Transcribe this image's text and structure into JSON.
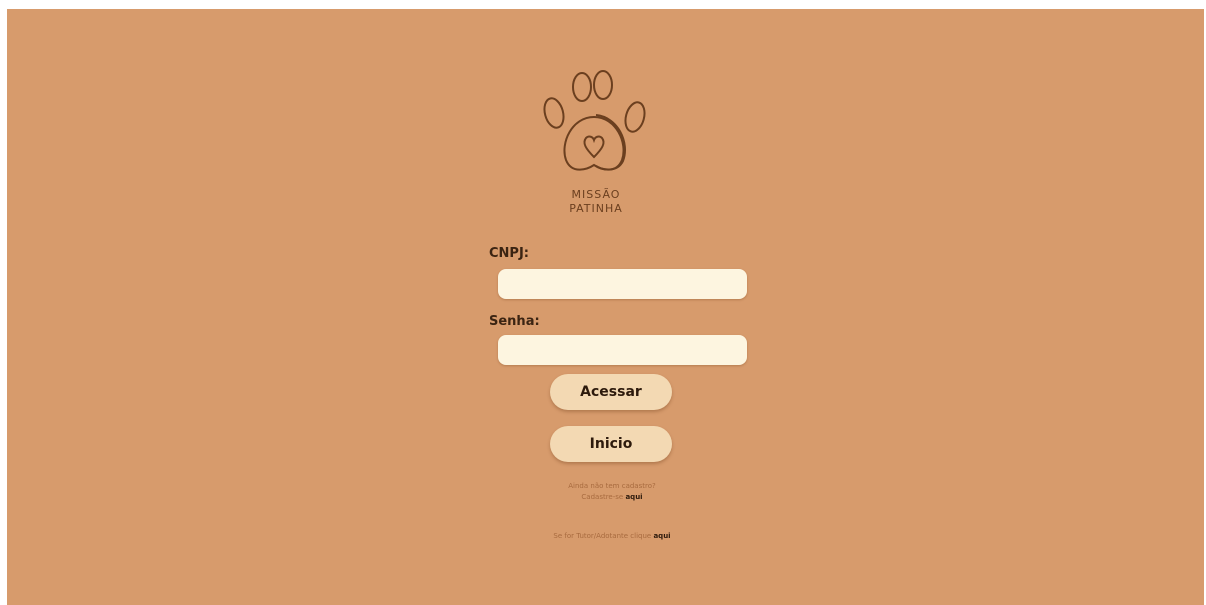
{
  "logo": {
    "line1": "MISSÃO",
    "line2": "PATINHA"
  },
  "form": {
    "cnpj_label": "CNPJ:",
    "cnpj_value": "",
    "senha_label": "Senha:",
    "senha_value": "",
    "access_button": "Acessar",
    "home_button": "Inicio"
  },
  "footer": {
    "no_account_text": "Ainda não tem cadastro?",
    "register_prefix": "Cadastre-se ",
    "register_link": "aqui",
    "tutor_prefix": "Se for Tutor/Adotante clique ",
    "tutor_link": "aqui"
  },
  "colors": {
    "background": "#d79b6c",
    "input": "#fdf5e0",
    "button": "#f3d9b3",
    "logo": "#6b3f1f"
  }
}
